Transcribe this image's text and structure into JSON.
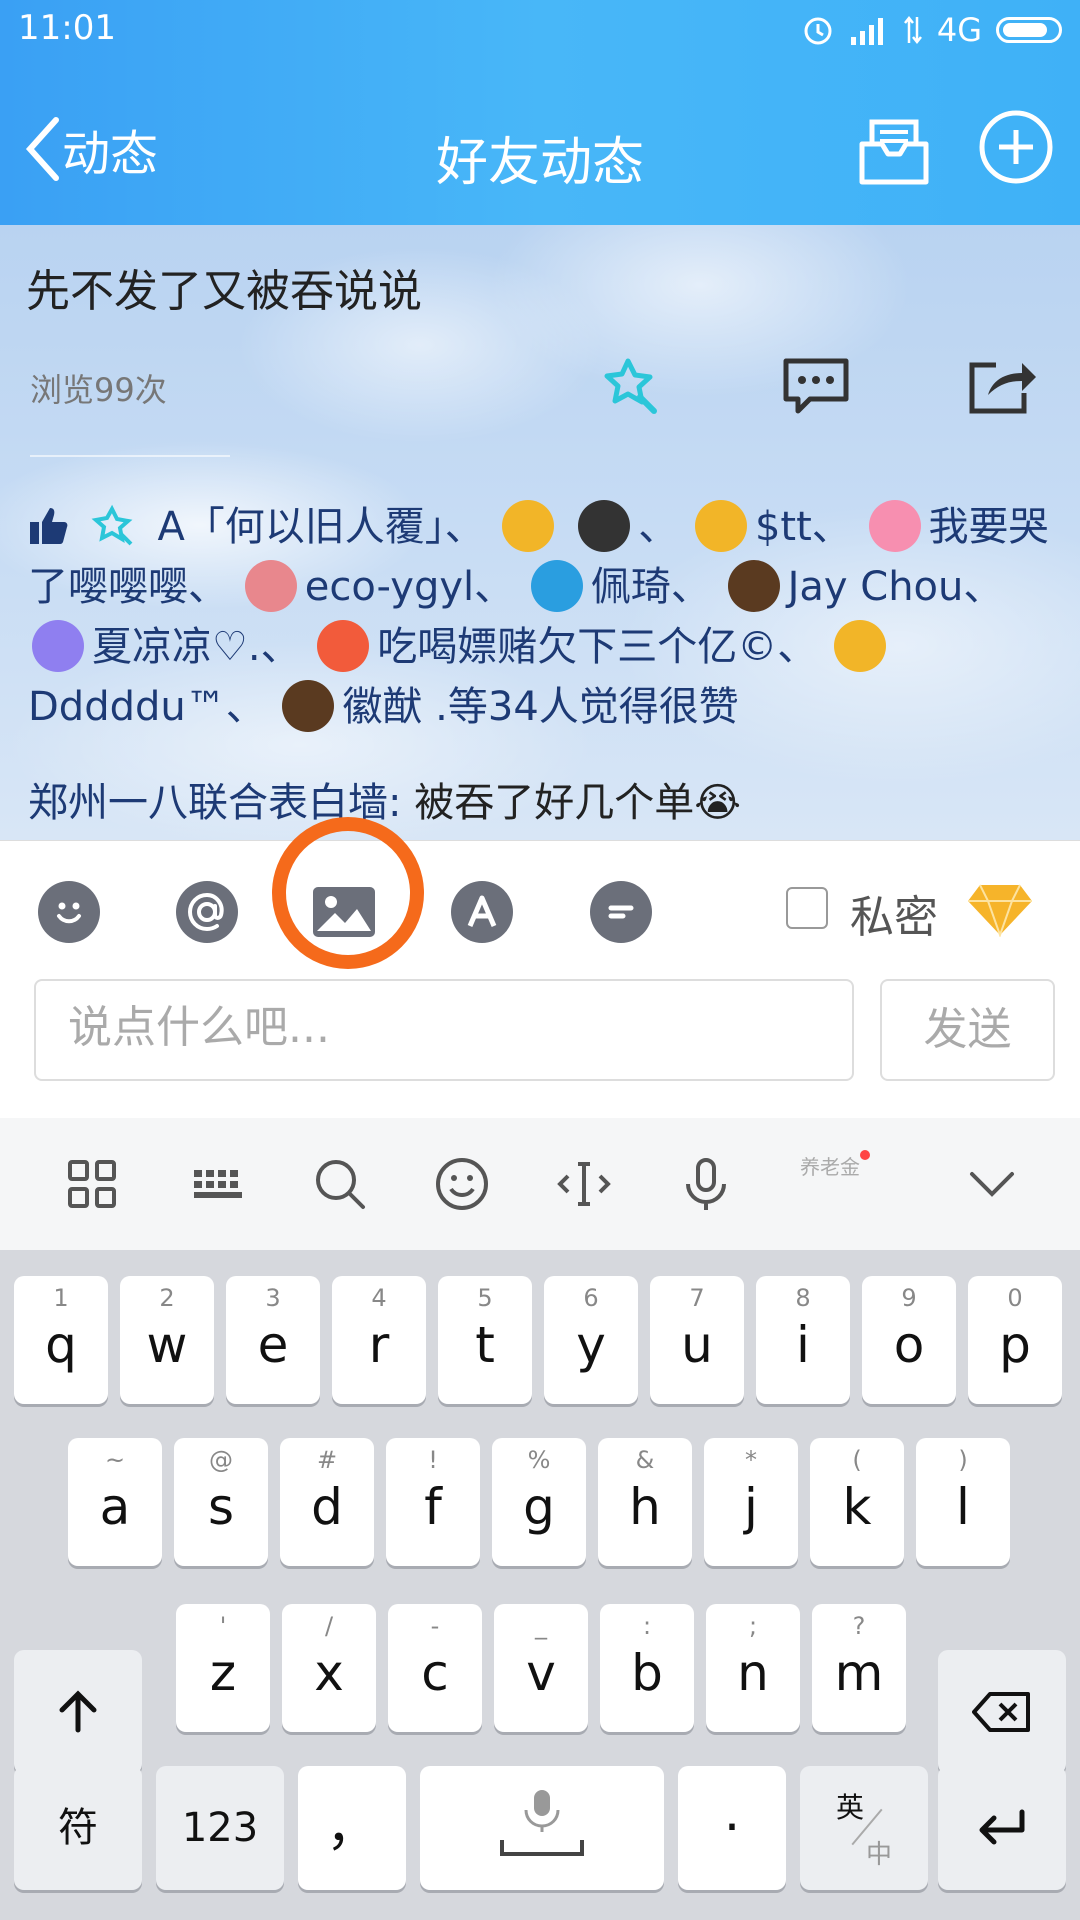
{
  "status_bar": {
    "time": "11:01",
    "network": "4G"
  },
  "nav": {
    "back_label": "动态",
    "title": "好友动态"
  },
  "post": {
    "text": "先不发了又被吞说说",
    "views": "浏览99次",
    "likes_segments": [
      "A「何以旧人覆」、",
      "、",
      "$tt、",
      "我要哭了嘤嘤嘤、",
      "eco-ygyl、",
      "佩琦、",
      "Jay Chou、",
      "夏凉凉♡.、",
      "吃喝嫖赌欠下三个亿©、",
      "Dddddu™、",
      "徽猷 .",
      "等34人觉得很赞"
    ],
    "comment_author": "郑州一八联合表白墙:",
    "comment_body": " 被吞了好几个单😭"
  },
  "composer": {
    "private_label": "私密",
    "placeholder": "说点什么吧...",
    "send_label": "发送"
  },
  "keyboard": {
    "row1": [
      {
        "sub": "1",
        "key": "q"
      },
      {
        "sub": "2",
        "key": "w"
      },
      {
        "sub": "3",
        "key": "e"
      },
      {
        "sub": "4",
        "key": "r"
      },
      {
        "sub": "5",
        "key": "t"
      },
      {
        "sub": "6",
        "key": "y"
      },
      {
        "sub": "7",
        "key": "u"
      },
      {
        "sub": "8",
        "key": "i"
      },
      {
        "sub": "9",
        "key": "o"
      },
      {
        "sub": "0",
        "key": "p"
      }
    ],
    "row2": [
      {
        "sub": "~",
        "key": "a"
      },
      {
        "sub": "@",
        "key": "s"
      },
      {
        "sub": "#",
        "key": "d"
      },
      {
        "sub": "!",
        "key": "f"
      },
      {
        "sub": "%",
        "key": "g"
      },
      {
        "sub": "&",
        "key": "h"
      },
      {
        "sub": "*",
        "key": "j"
      },
      {
        "sub": "(",
        "key": "k"
      },
      {
        "sub": ")",
        "key": "l"
      }
    ],
    "row3": [
      {
        "sub": "'",
        "key": "z"
      },
      {
        "sub": "/",
        "key": "x"
      },
      {
        "sub": "-",
        "key": "c"
      },
      {
        "sub": "_",
        "key": "v"
      },
      {
        "sub": ":",
        "key": "b"
      },
      {
        "sub": ";",
        "key": "n"
      },
      {
        "sub": "?",
        "key": "m"
      }
    ],
    "symbol_label": "符",
    "number_label": "123",
    "comma_label": "，",
    "period_label": "·",
    "lang_top": "英",
    "lang_bottom": "中",
    "pension_label": "养老金"
  },
  "colors": {
    "header": "#3fb1f7",
    "highlight": "#f56a1b",
    "like_text": "#1d3a75"
  }
}
